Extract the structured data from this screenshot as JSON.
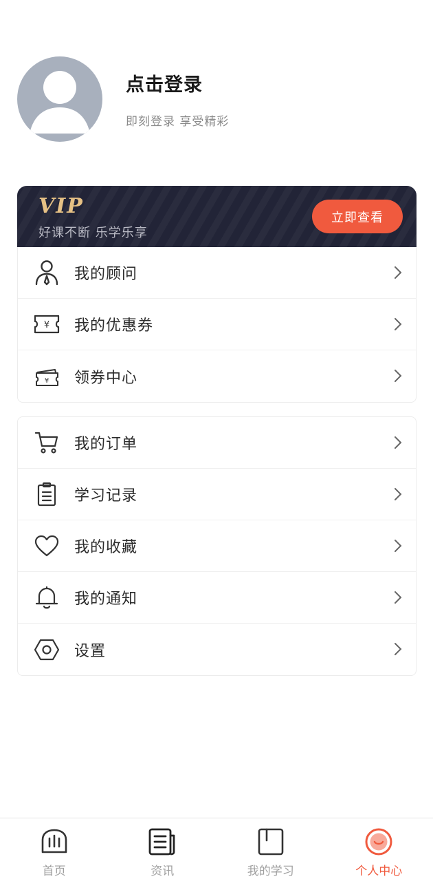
{
  "profile": {
    "title": "点击登录",
    "subtitle": "即刻登录 享受精彩",
    "avatar_icon": "default-user-avatar"
  },
  "vip": {
    "logo": "VIP",
    "slogan": "好课不断 乐学乐享",
    "button": "立即查看",
    "colors": {
      "background": "#222437",
      "logo": "#e6c185",
      "button": "#f05a3e"
    }
  },
  "menu_group_1": [
    {
      "label": "我的顾问",
      "icon": "advisor-icon"
    },
    {
      "label": "我的优惠券",
      "icon": "coupon-icon"
    },
    {
      "label": "领券中心",
      "icon": "coupon-center-icon"
    }
  ],
  "menu_group_2": [
    {
      "label": "我的订单",
      "icon": "cart-icon"
    },
    {
      "label": "学习记录",
      "icon": "clipboard-icon"
    },
    {
      "label": "我的收藏",
      "icon": "heart-icon"
    },
    {
      "label": "我的通知",
      "icon": "bell-icon"
    },
    {
      "label": "设置",
      "icon": "settings-hexagon-icon"
    }
  ],
  "tabbar": {
    "active": "个人中心",
    "accent_color": "#f05a3e",
    "items": [
      {
        "label": "首页",
        "icon": "home-chart-icon"
      },
      {
        "label": "资讯",
        "icon": "news-icon"
      },
      {
        "label": "我的学习",
        "icon": "book-icon"
      },
      {
        "label": "个人中心",
        "icon": "smile-face-icon"
      }
    ]
  }
}
